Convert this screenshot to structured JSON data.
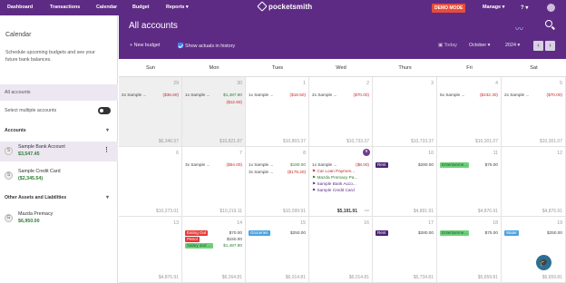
{
  "nav": {
    "items": [
      "Dashboard",
      "Transactions",
      "Calendar",
      "Budget",
      "Reports ▾"
    ],
    "logo": "pocketsmith",
    "demo": "DEMO MODE",
    "manage": "Manage ▾",
    "help": "? ▾"
  },
  "sidebar": {
    "title": "Calendar",
    "description": "Schedule upcoming budgets and see your future bank balances.",
    "all_accounts": "All accounts",
    "select_multiple": "Select multiple accounts",
    "accounts_heading": "Accounts",
    "accounts": [
      {
        "initial": "S",
        "name": "Sample Bank Account",
        "balance": "$3,547.45"
      },
      {
        "initial": "S",
        "name": "Sample Credit Card",
        "balance": "($2,345.54)"
      }
    ],
    "other_heading": "Other Assets and Liabilities",
    "other_accounts": [
      {
        "initial": "G",
        "name": "Mazda Premacy",
        "balance": "$6,950.00"
      }
    ]
  },
  "header": {
    "title": "All accounts",
    "new_budget": "+ New budget",
    "show_actuals": "Show actuals in history",
    "today": "Today",
    "month": "October ▾",
    "year": "2024 ▾"
  },
  "calendar": {
    "days": [
      "Sun",
      "Mon",
      "Tues",
      "Wed",
      "Thurs",
      "Fri",
      "Sat"
    ],
    "week1": {
      "d": [
        "29",
        "30",
        "1",
        "2",
        "3",
        "4",
        "5"
      ],
      "b": [
        "$6,346.57",
        "$10,821.87",
        "$10,803.37",
        "$10,733.37",
        "$10,733.37",
        "$10,301.07",
        "$10,301.07"
      ],
      "sun": {
        "l": "2x Sample ...",
        "a": "($36.60)"
      },
      "mon1": {
        "l": "1x Sample ...",
        "a": "$1,487.90"
      },
      "mon2": {
        "l": "",
        "a": "($12.60)"
      },
      "tue": {
        "l": "1x Sample ...",
        "a": "($18.50)"
      },
      "wed": {
        "l": "2x Sample ...",
        "a": "($70.00)"
      },
      "fri": {
        "l": "5x Sample ...",
        "a": "($432.30)"
      },
      "sat": {
        "l": "2x Sample ...",
        "a": "($70.00)"
      }
    },
    "week2": {
      "d": [
        "6",
        "7",
        "8",
        "9",
        "10",
        "11",
        "12"
      ],
      "b": [
        "$10,273.01",
        "$10,219.11",
        "$10,099.91",
        "$5,191.91",
        "$4,891.91",
        "$4,876.91",
        "$4,876.91"
      ],
      "mon": {
        "l": "3x Sample ...",
        "a": "($54.00)"
      },
      "tue1": {
        "l": "1x Sample ...",
        "a": "$180.00"
      },
      "tue2": {
        "l": "3x Sample ...",
        "a": "($179.20)"
      },
      "wed1": {
        "l": "1x Sample ...",
        "a": "($8.00)"
      },
      "wed2": "Car Loan Paymen...",
      "wed3": "Mazda Premacy Pa...",
      "wed4": "Sample Bank Acco...",
      "wed5": "Sample Credit Card",
      "wed_more": "···",
      "thu": {
        "tag": "Rent",
        "a": "$280.00"
      },
      "fri": {
        "tag": "Entertainme...",
        "a": "$75.00"
      }
    },
    "week3": {
      "d": [
        "13",
        "14",
        "15",
        "16",
        "17",
        "18",
        "19"
      ],
      "b": [
        "$4,876.91",
        "$6,264.81",
        "$6,014.81",
        "$6,014.81",
        "$5,734.81",
        "$5,659.81",
        "$5,659.81"
      ],
      "mon1": {
        "tag": "Eating Out",
        "a": "$70.00"
      },
      "mon2": {
        "tag": "Petrol",
        "a": "$150.00"
      },
      "mon3": {
        "tag": "Salary and ...",
        "a": "$1,487.90"
      },
      "tue": {
        "tag": "Groceries",
        "a": "$250.00"
      },
      "thu": {
        "tag": "Rent",
        "a": "$280.00"
      },
      "fri": {
        "tag": "Entertainme...",
        "a": "$75.00"
      },
      "sat": {
        "tag": "Water",
        "a": "$250.00"
      }
    }
  },
  "colors": {
    "brand": "#5e2b84",
    "negative": "#c62828",
    "positive": "#2e7d32"
  }
}
